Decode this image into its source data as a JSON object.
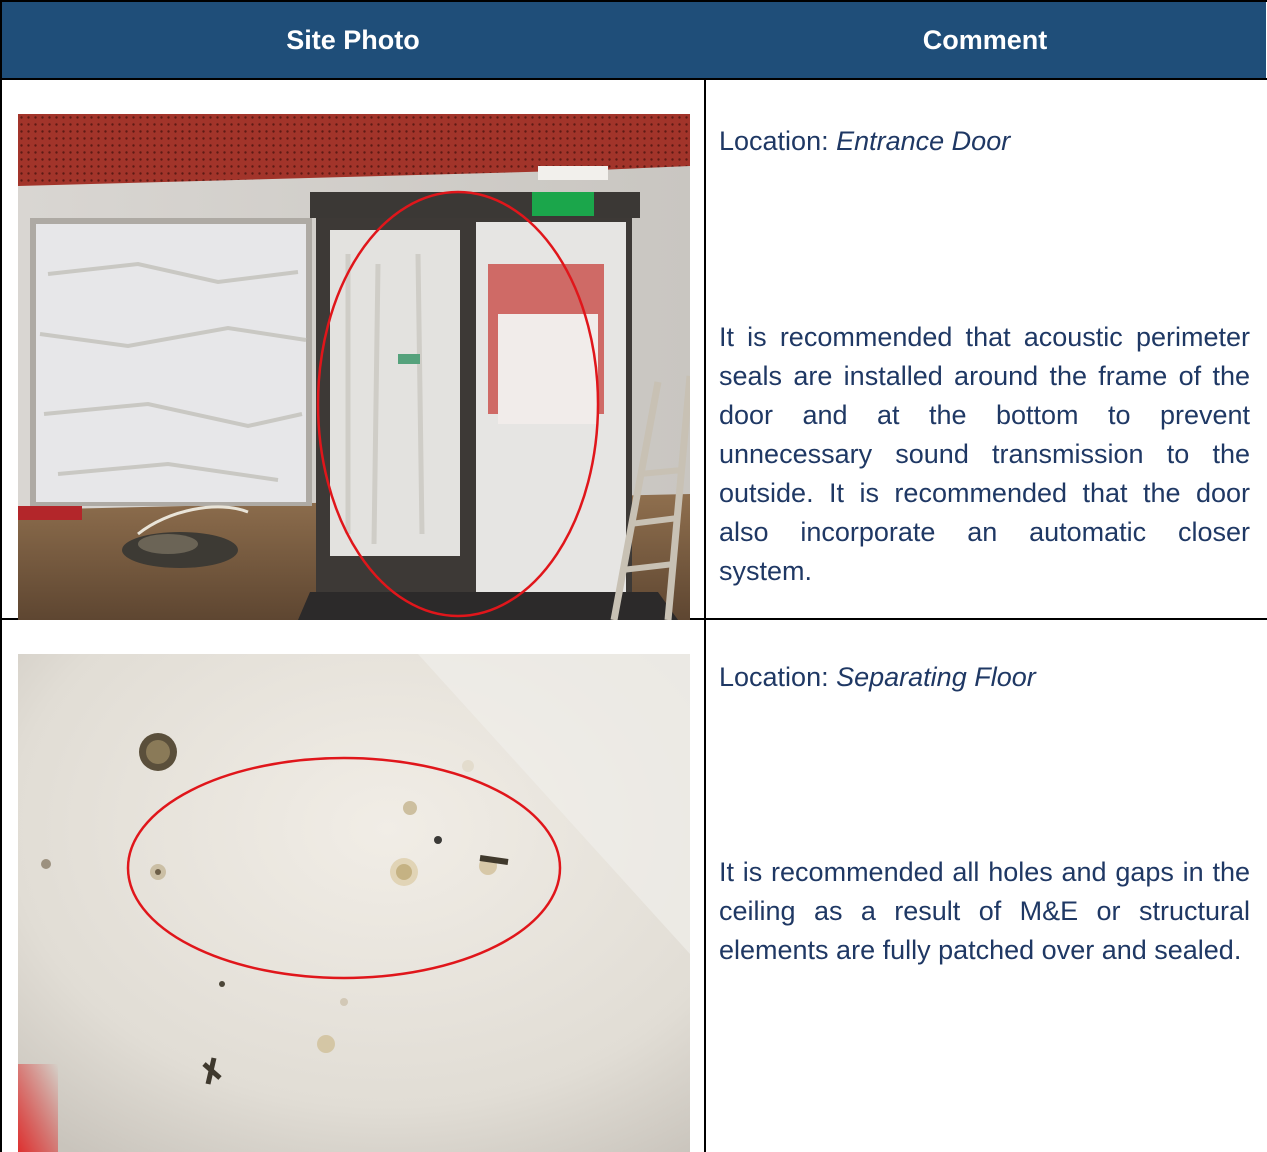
{
  "table": {
    "headers": {
      "photo": "Site Photo",
      "comment": "Comment"
    },
    "rows": [
      {
        "location_label": "Location:",
        "location_value": "Entrance Door",
        "comment": "It is recommended that acoustic perimeter seals are installed around the frame of the door and at the bottom to prevent unnecessary sound transmission to the outside. It is recommended that the door also incorporate an automatic closer system."
      },
      {
        "location_label": "Location:",
        "location_value": "Separating Floor",
        "comment": "It is recommended all holes and gaps in the ceiling as a result of M&E or structural elements are fully patched over and sealed."
      }
    ]
  },
  "colors": {
    "header_bg": "#1f4e79",
    "text": "#1f3864",
    "highlight_ring": "#e0161b"
  }
}
